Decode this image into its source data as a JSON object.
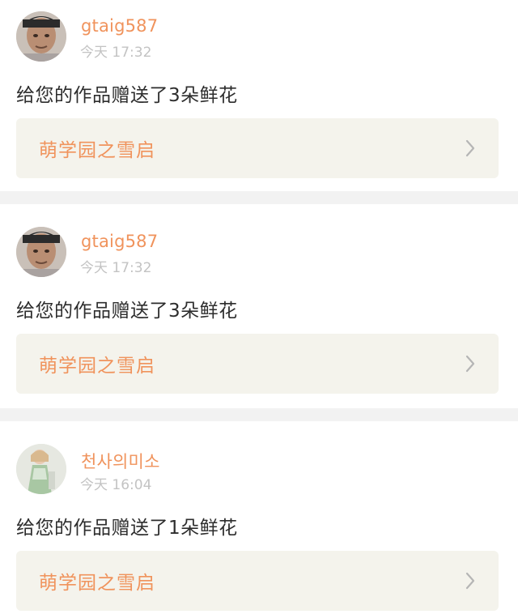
{
  "feed": {
    "items": [
      {
        "username": "gtaig587",
        "time": "今天 17:32",
        "message": "给您的作品赠送了3朵鲜花",
        "work_title": "萌学园之雪启",
        "avatar_icon": "user-avatar-icon"
      },
      {
        "username": "gtaig587",
        "time": "今天 17:32",
        "message": "给您的作品赠送了3朵鲜花",
        "work_title": "萌学园之雪启",
        "avatar_icon": "user-avatar-icon"
      },
      {
        "username": "천사의미소",
        "time": "今天 16:04",
        "message": "给您的作品赠送了1朵鲜花",
        "work_title": "萌学园之雪启",
        "avatar_icon": "user-avatar-icon"
      }
    ]
  },
  "colors": {
    "accent": "#f0935c",
    "card_bg": "#f4f3ec",
    "divider": "#f2f2f2",
    "muted_text": "#c3c3c3",
    "body_text": "#2d2d2d"
  }
}
